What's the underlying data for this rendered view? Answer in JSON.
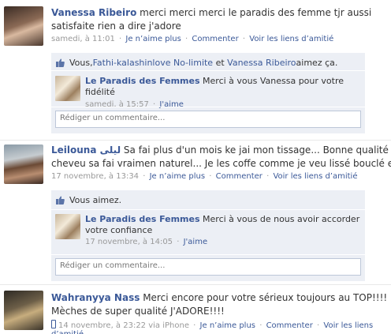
{
  "posts": [
    {
      "author": "Vanessa Ribeiro",
      "text_line1": "merci merci merci le paradis des femme tjr aussi",
      "text_line2": "satisfaite rien a dire j'adore",
      "timestamp": "samedi, à 11:01",
      "unlike": "Je n’aime plus",
      "comment": "Commenter",
      "friendship": "Voir les liens d’amitié",
      "likes_prefix": "Vous, ",
      "liker1": "Fathi-kalashinlove No-limite",
      "likes_and": " et ",
      "liker2": "Vanessa Ribeiro",
      "likes_suffix": " aimez ça.",
      "reply": {
        "author": "Le Paradis des Femmes",
        "text": "Merci à vous Vanessa pour votre fidélité",
        "timestamp": "samedi, à 15:57",
        "like": "J'aime"
      },
      "comment_placeholder": "Rédiger un commentaire..."
    },
    {
      "author": "Leilouna ليلى",
      "text_line1": "Sa fai plus d'un mois ke jai mon tissage... Bonne qualité de",
      "text_line2": "cheveu sa fai vraimen naturel... Je les coffe comme je veu lissé bouclé etc..",
      "timestamp": "17 novembre, à 13:34",
      "unlike": "Je n’aime plus",
      "comment": "Commenter",
      "friendship": "Voir les liens d’amitié",
      "likes_text": "Vous aimez.",
      "reply": {
        "author": "Le Paradis des Femmes",
        "text_line1": "Merci à vous de nous avoir accorder",
        "text_line2": "votre confiance",
        "timestamp": "17 novembre, à 14:05",
        "like": "J'aime"
      },
      "comment_placeholder": "Rédiger un commentaire..."
    },
    {
      "author": "Wahranyya Nass",
      "text_line1": "Merci encore pour votre sérieux toujours au TOP!!!!",
      "text_line2": "Mèches de super qualité J'ADORE!!!!",
      "timestamp": "14 novembre, à 23:22 via iPhone",
      "unlike": "Je n’aime plus",
      "comment": "Commenter",
      "friendship": "Voir les liens d’amitié"
    }
  ],
  "separator": "·",
  "colors": {
    "link": "#3b5998",
    "box": "#eceff5",
    "meta": "#999999"
  },
  "icons": [
    "thumbs-up-icon",
    "iphone-icon"
  ]
}
